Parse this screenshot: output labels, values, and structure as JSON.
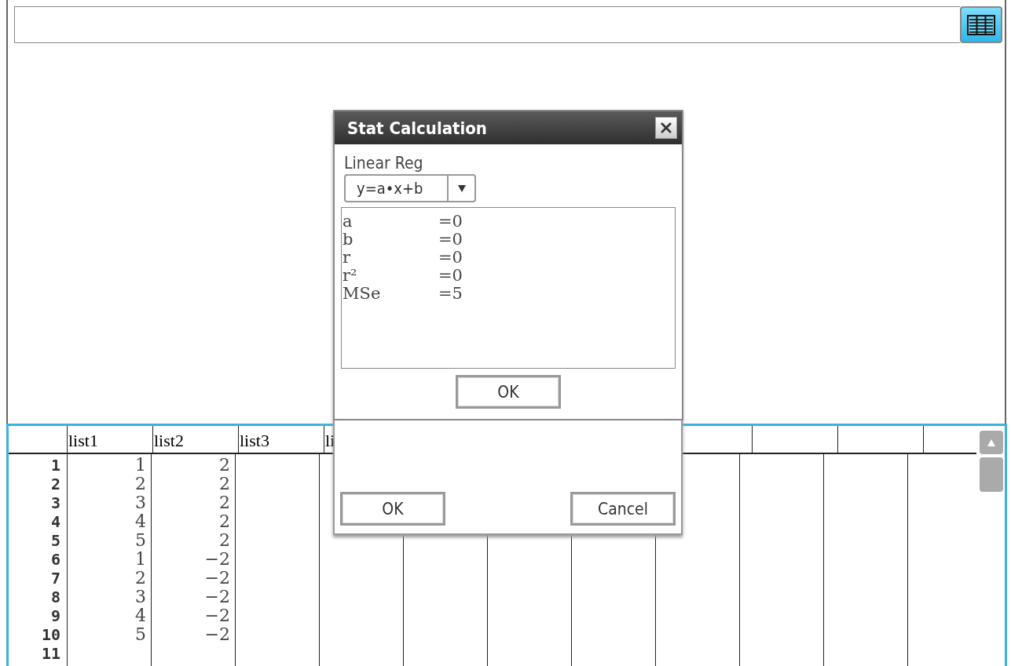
{
  "stat_dialog": {
    "title": "Stat Calculation",
    "calculation": "Linear Reg",
    "model": "y=a•x+b",
    "results": [
      {
        "name": "a",
        "value": "=0"
      },
      {
        "name": "b",
        "value": "=0"
      },
      {
        "name": "r",
        "value": "=0"
      },
      {
        "name": "r²",
        "value": "=0"
      },
      {
        "name": "MSe",
        "value": "=5"
      }
    ],
    "ok_button": "OK"
  },
  "back_dialog": {
    "buttons": [
      "OK",
      "Cancel"
    ]
  },
  "list_table": {
    "columns": [
      "list1",
      "list2",
      "list3",
      "li"
    ],
    "rows": [
      {
        "number": "1",
        "cells": [
          "1",
          "2"
        ]
      },
      {
        "number": "2",
        "cells": [
          "2",
          "2"
        ]
      },
      {
        "number": "3",
        "cells": [
          "3",
          "2"
        ]
      },
      {
        "number": "4",
        "cells": [
          "4",
          "2"
        ]
      },
      {
        "number": "5",
        "cells": [
          "5",
          "2"
        ]
      },
      {
        "number": "6",
        "cells": [
          "1",
          "−2"
        ]
      },
      {
        "number": "7",
        "cells": [
          "2",
          "−2"
        ]
      },
      {
        "number": "8",
        "cells": [
          "3",
          "−2"
        ]
      },
      {
        "number": "9",
        "cells": [
          "4",
          "−2"
        ]
      },
      {
        "number": "10",
        "cells": [
          "5",
          "−2"
        ]
      },
      {
        "number": "11"
      }
    ]
  }
}
